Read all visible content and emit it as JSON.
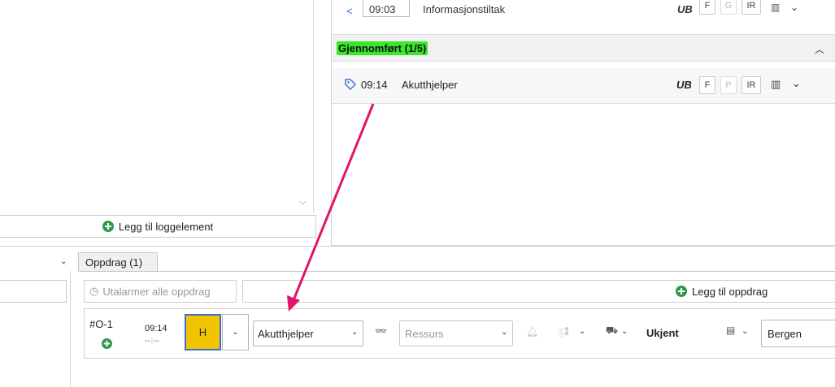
{
  "top_row": {
    "time": "09:03",
    "label": "Informasjonstiltak",
    "ub": "UB",
    "b1": "F",
    "b2": "G",
    "b3": "IR"
  },
  "section": {
    "title": "Gjennomført (1/5)",
    "highlight": "#38e82a"
  },
  "log_row": {
    "time": "09:14",
    "label": "Akutthjelper",
    "ub": "UB",
    "b1": "F",
    "b2": "P",
    "b3": "IR"
  },
  "add_log": {
    "label": "Legg til loggelement"
  },
  "tab": {
    "label": "Oppdrag (1)"
  },
  "toolbar": {
    "unalarm_label": "Utalarmer alle oppdrag",
    "add_label": "Legg til oppdrag"
  },
  "mission": {
    "id": "#O-1",
    "time": "09:14",
    "time2": "--:--",
    "priority": "H",
    "type": "Akutthjelper",
    "resource_placeholder": "Ressurs",
    "status": "Ukjent",
    "location": "Bergen"
  },
  "colors": {
    "accent_arrow": "#e2156b",
    "priority_bg": "#f2c400",
    "green_icon": "#2d9a4a"
  }
}
